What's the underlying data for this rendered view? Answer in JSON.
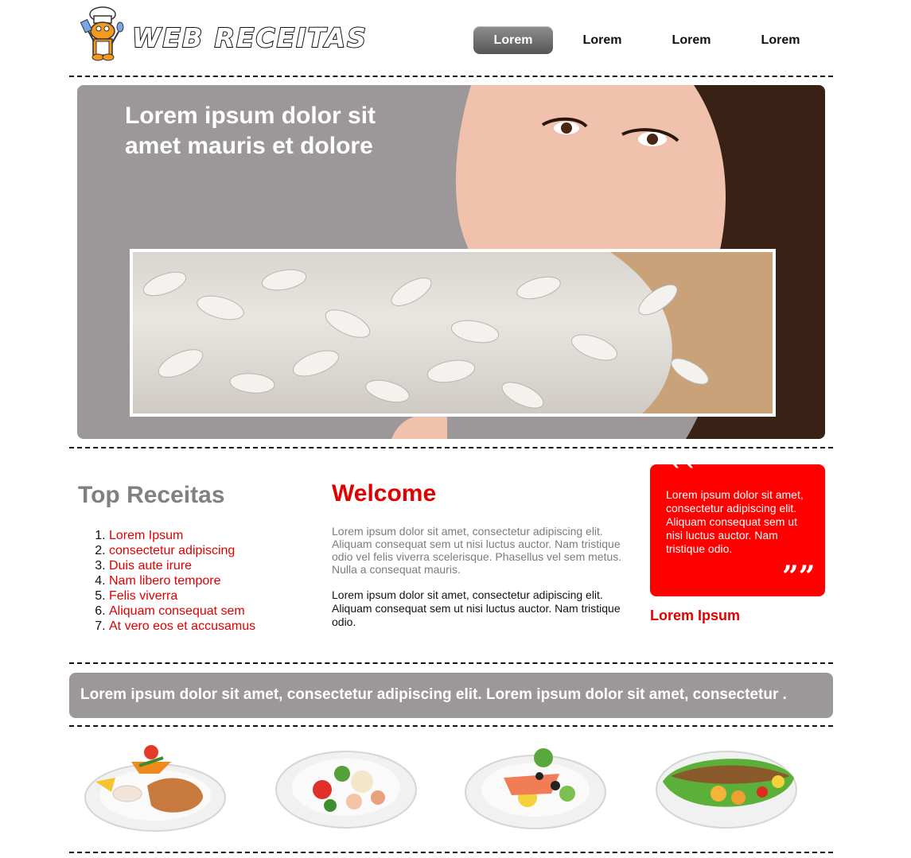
{
  "header": {
    "logo_text": "WEB RECEITAS",
    "nav": [
      "Lorem",
      "Lorem",
      "Lorem",
      "Lorem"
    ]
  },
  "hero": {
    "title": "Lorem ipsum dolor sit amet mauris et dolore"
  },
  "top_receitas": {
    "title": "Top Receitas",
    "items": [
      "Lorem Ipsum",
      "consectetur adipiscing",
      "Duis aute irure",
      "Nam libero tempore",
      "Felis viverra",
      "Aliquam consequat sem",
      "At vero eos et accusamus"
    ]
  },
  "welcome": {
    "title": "Welcome",
    "p1": "Lorem ipsum dolor sit amet, consectetur adipiscing elit. Aliquam consequat sem ut nisi luctus auctor. Nam tristique odio vel felis viverra scelerisque. Phasellus vel sem metus. Nulla a consequat mauris.",
    "p2": "Lorem ipsum dolor sit amet, consectetur adipiscing elit. Aliquam consequat sem ut nisi luctus auctor. Nam tristique odio."
  },
  "quote": {
    "open_mark": "``",
    "text": "Lorem ipsum dolor sit amet, consectetur adipiscing elit. Aliquam consequat sem ut nisi luctus auctor. Nam tristique odio.",
    "close_mark": "””",
    "author": "Lorem Ipsum"
  },
  "banner": {
    "text": "Lorem ipsum dolor sit amet, consectetur adipiscing elit. Lorem ipsum dolor sit amet, consectetur ."
  },
  "colors": {
    "accent_red": "#ff0000",
    "panel_gray": "#9c9899"
  }
}
